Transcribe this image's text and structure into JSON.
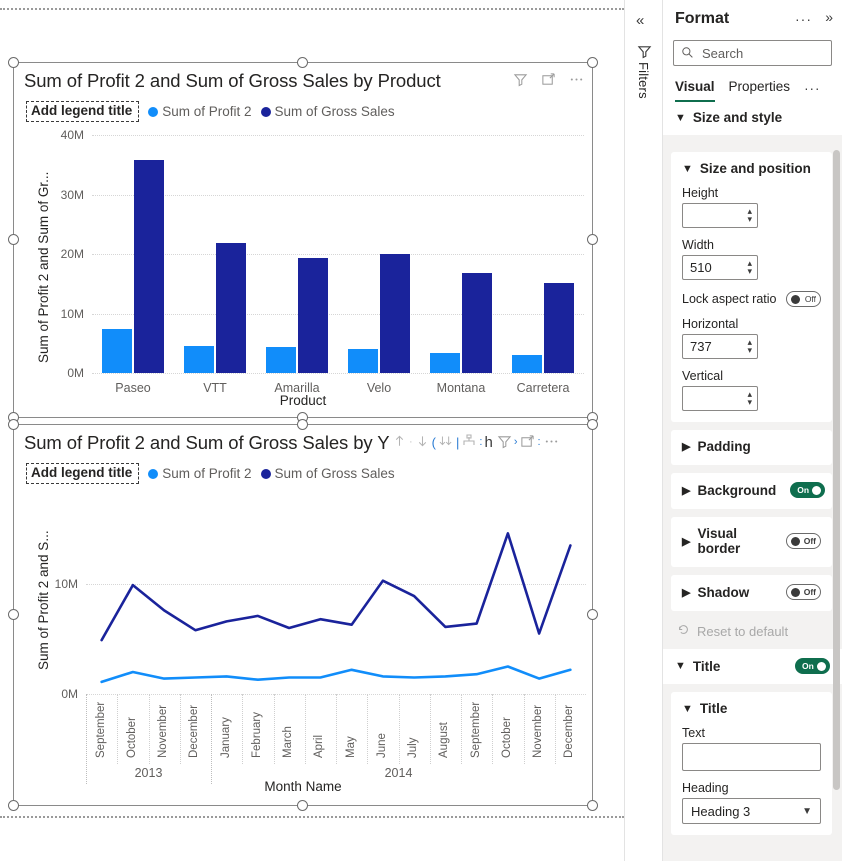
{
  "canvas": {
    "visuals": [
      {
        "id": "bar-visual",
        "title": "Sum of Profit 2 and Sum of Gross Sales by Product",
        "legend_title_placeholder": "Add legend title",
        "legend": [
          {
            "label": "Sum of Profit 2",
            "color": "#118DFA"
          },
          {
            "label": "Sum of Gross Sales",
            "color": "#1A239B"
          }
        ],
        "header_icons": [
          "filter-icon",
          "focus-mode-icon",
          "more-options-icon"
        ]
      },
      {
        "id": "line-visual",
        "title": "Sum of Profit 2 and Sum of Gross Sales by Y",
        "legend_title_placeholder": "Add legend title",
        "legend": [
          {
            "label": "Sum of Profit 2",
            "color": "#118DFA"
          },
          {
            "label": "Sum of Gross Sales",
            "color": "#1A239B"
          }
        ],
        "drill_icons": [
          "drill-up-icon",
          "drill-down-arrow-icon",
          "expand-all-icon",
          "drill-mode-icon",
          "hierarchy-icon",
          "filter-icon",
          "focus-mode-icon",
          "more-options-icon"
        ]
      }
    ]
  },
  "rail": {
    "collapse_label": "«",
    "filters_label": "Filters"
  },
  "format_pane": {
    "title": "Format",
    "more_label": "···",
    "expand_label": "»",
    "search": {
      "placeholder": "Search",
      "value": ""
    },
    "tabs": [
      {
        "label": "Visual",
        "active": true
      },
      {
        "label": "Properties",
        "active": false
      }
    ],
    "tabs_more": "···",
    "section_size_and_style": "Size and style",
    "size_and_position": {
      "header": "Size and position",
      "height_label": "Height",
      "height_value": "",
      "width_label": "Width",
      "width_value": "510",
      "lock_aspect_label": "Lock aspect ratio",
      "lock_aspect_state": "Off",
      "horizontal_label": "Horizontal",
      "horizontal_value": "737",
      "vertical_label": "Vertical",
      "vertical_value": ""
    },
    "cards": [
      {
        "label": "Padding",
        "toggle": null
      },
      {
        "label": "Background",
        "toggle": "On"
      },
      {
        "label": "Visual border",
        "toggle": "Off"
      },
      {
        "label": "Shadow",
        "toggle": "Off"
      }
    ],
    "reset_label": "Reset to default",
    "title_section": {
      "header": "Title",
      "toggle": "On",
      "sub_header": "Title",
      "text_label": "Text",
      "text_value": "",
      "heading_label": "Heading",
      "heading_value": "Heading 3"
    },
    "accent_color": "#0f6e4e"
  },
  "chart_data": [
    {
      "type": "bar",
      "title": "Sum of Profit 2 and Sum of Gross Sales by Product",
      "xlabel": "Product",
      "ylabel": "Sum of Profit 2 and Sum of Gr...",
      "ylabel_full": "Sum of Profit 2 and Sum of Gross Sales",
      "categories": [
        "Paseo",
        "VTT",
        "Amarilla",
        "Velo",
        "Montana",
        "Carretera"
      ],
      "ylim": [
        0,
        40000000
      ],
      "yticks": [
        0,
        10000000,
        20000000,
        30000000,
        40000000
      ],
      "ytick_labels": [
        "0M",
        "10M",
        "20M",
        "30M",
        "40M"
      ],
      "grid": true,
      "legend_position": "top",
      "series": [
        {
          "name": "Sum of Profit 2",
          "color": "#118DFA",
          "values": [
            7400000,
            4600000,
            4300000,
            4000000,
            3300000,
            3000000
          ]
        },
        {
          "name": "Sum of Gross Sales",
          "color": "#1A239B",
          "values": [
            35800000,
            21800000,
            19300000,
            20000000,
            16800000,
            15200000
          ]
        }
      ]
    },
    {
      "type": "line",
      "title": "Sum of Profit 2 and Sum of Gross Sales by Y",
      "xlabel": "Month Name",
      "ylabel": "Sum of Profit 2 and S...",
      "ylabel_full": "Sum of Profit 2 and Sum of Gross Sales",
      "x": [
        "September",
        "October",
        "November",
        "December",
        "January",
        "February",
        "March",
        "April",
        "May",
        "June",
        "July",
        "August",
        "September",
        "October",
        "November",
        "December"
      ],
      "x_groups": [
        {
          "label": "2013",
          "count": 4
        },
        {
          "label": "2014",
          "count": 12
        }
      ],
      "ylim": [
        0,
        17000000
      ],
      "yticks": [
        0,
        10000000
      ],
      "ytick_labels": [
        "0M",
        "10M"
      ],
      "grid": true,
      "legend_position": "top",
      "series": [
        {
          "name": "Sum of Profit 2",
          "color": "#118DFA",
          "values": [
            1100000,
            2000000,
            1400000,
            1500000,
            1600000,
            1300000,
            1500000,
            1500000,
            2200000,
            1600000,
            1500000,
            1600000,
            1800000,
            2500000,
            1400000,
            2200000
          ]
        },
        {
          "name": "Sum of Gross Sales",
          "color": "#1A239B",
          "values": [
            4900000,
            9900000,
            7600000,
            5800000,
            6600000,
            7100000,
            6000000,
            6800000,
            6300000,
            10300000,
            8900000,
            6100000,
            6400000,
            14600000,
            5500000,
            13500000
          ]
        }
      ]
    }
  ]
}
